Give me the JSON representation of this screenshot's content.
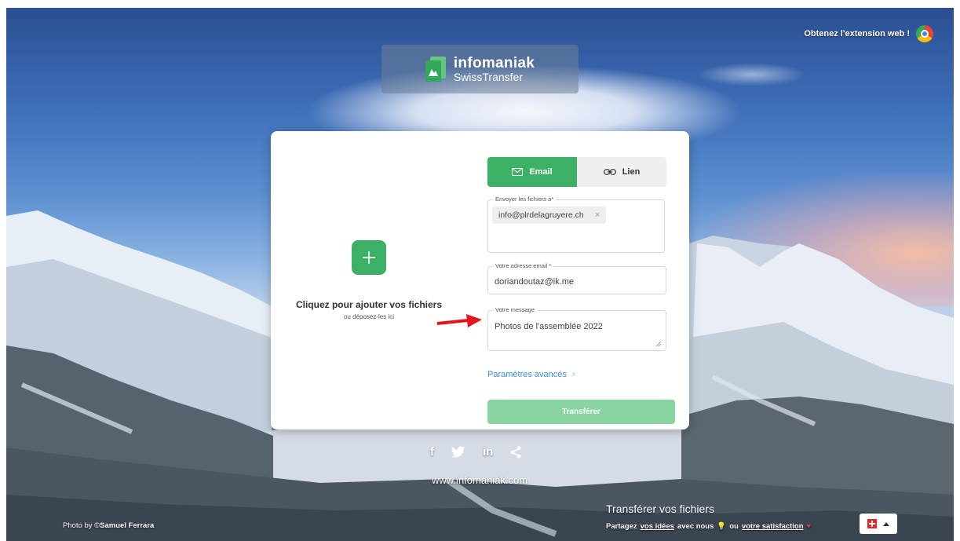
{
  "header": {
    "extension_label": "Obtenez l'extension web !",
    "logo_title": "infomaniak",
    "logo_subtitle": "SwissTransfer"
  },
  "upload": {
    "title": "Cliquez pour ajouter vos fichiers",
    "subtitle": "ou déposez-les ici"
  },
  "tabs": [
    {
      "label": "Email",
      "icon": "envelope-icon",
      "active": true
    },
    {
      "label": "Lien",
      "icon": "link-icon",
      "active": false
    }
  ],
  "form": {
    "recipients_label": "Envoyer les fichiers à*",
    "recipient_chip": "info@plrdelagruyere.ch",
    "chip_remove": "×",
    "email_label": "Votre adresse email *",
    "email_value": "doriandoutaz@ik.me",
    "message_label": "Votre message",
    "message_value": "Photos de l'assemblée 2022",
    "advanced_label": "Paramètres avancés",
    "submit_label": "Transférer"
  },
  "footer": {
    "social": [
      "f",
      "in"
    ],
    "website": "www.infomaniak.com",
    "photo_prefix": "Photo by ©",
    "photo_author": "Samuel Ferrara",
    "promo_title": "Transférer vos fichiers",
    "share_text_1": "Partagez",
    "share_link_1": "vos idées",
    "share_text_2": "avec nous",
    "share_text_3": "ou",
    "share_link_2": "votre satisfaction",
    "bulb": "💡",
    "heart": "♥"
  },
  "colors": {
    "accent": "#3cb166",
    "accent_disabled": "#88d4a3",
    "link": "#3b8fd6",
    "annotation_arrow": "#e8141b"
  }
}
